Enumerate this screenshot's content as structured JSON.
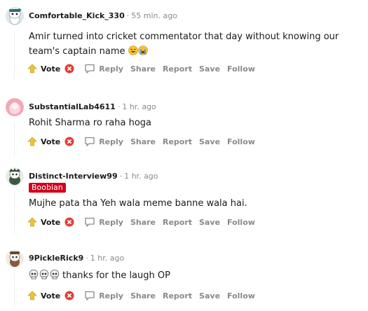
{
  "comments": [
    {
      "author": "Comfortable_Kick_330",
      "time": "55 min. ago",
      "flair": null,
      "body": "Amir turned into cricket commentator that day without knowing our team's captain name",
      "emojis": [
        "rofl-emoji",
        "crying-emoji"
      ],
      "avatar": "snoo-avatar-teal"
    },
    {
      "author": "SubstantialLab4611",
      "time": "1 hr. ago",
      "flair": null,
      "body": "Rohit Sharma ro raha hoga",
      "emojis": [],
      "avatar": "snoo-avatar-pink"
    },
    {
      "author": "Distinct-Interview99",
      "time": "1 hr. ago",
      "flair": "Boobian",
      "body": "Mujhe pata tha Yeh wala meme banne wala hai.",
      "emojis": [],
      "avatar": "snoo-avatar-green"
    },
    {
      "author": "9PickleRick9",
      "time": "1 hr. ago",
      "flair": null,
      "body": "thanks for the laugh OP",
      "emojis": [
        "skull-emoji",
        "skull-emoji",
        "skull-emoji"
      ],
      "avatar": "snoo-avatar-brown"
    }
  ],
  "actions": {
    "vote": "Vote",
    "reply": "Reply",
    "share": "Share",
    "report": "Report",
    "save": "Save",
    "follow": "Follow"
  },
  "colors": {
    "meta_gray": "#878a8c",
    "flair_red": "#d0021b",
    "vote_yellow": "#f2c230",
    "downvote_red": "#e0403a",
    "thread_line": "#edeff1"
  }
}
